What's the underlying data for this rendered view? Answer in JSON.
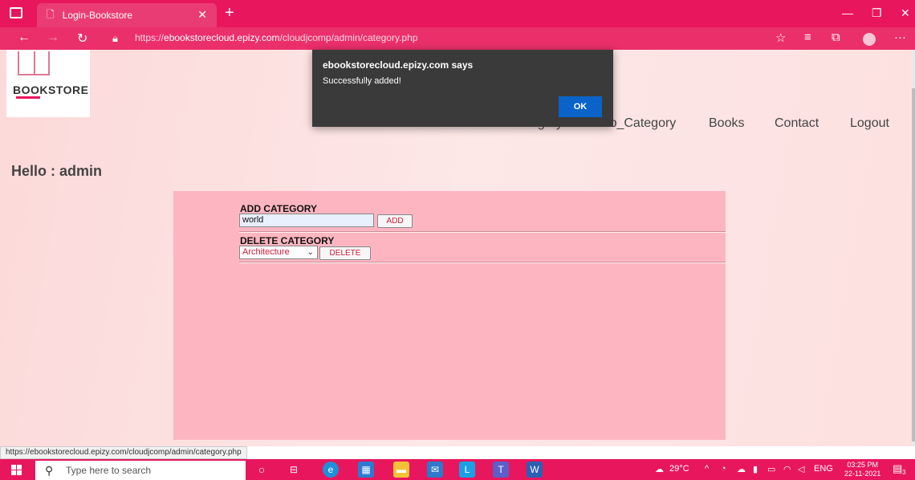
{
  "browser": {
    "tab_title": "Login-Bookstore",
    "url_prefix": "https://",
    "url_domain": "ebookstorecloud.epizy.com",
    "url_path": "/cloudjcomp/admin/category.php",
    "status_url": "https://ebookstorecloud.epizy.com/cloudjcomp/admin/category.php"
  },
  "logo": {
    "text_a": "BOOK",
    "text_b": "STORE"
  },
  "nav": {
    "category": "Category",
    "sub_category": "Sub_Category",
    "books": "Books",
    "contact": "Contact",
    "logout": "Logout"
  },
  "greeting": "Hello : admin",
  "add_category": {
    "label": "ADD CATEGORY",
    "value": "world",
    "button": "ADD"
  },
  "delete_category": {
    "label": "DELETE CATEGORY",
    "selected": "Architecture",
    "button": "DELETE"
  },
  "dialog": {
    "title": "ebookstorecloud.epizy.com says",
    "message": "Successfully added!",
    "ok": "OK"
  },
  "taskbar": {
    "search_placeholder": "Type here to search",
    "weather": "29°C",
    "lang": "ENG",
    "time": "03:25 PM",
    "date": "22-11-2021",
    "notifications": "3"
  },
  "icons": {
    "back": "arrow-left-icon",
    "forward": "arrow-right-icon",
    "refresh": "refresh-icon",
    "lock": "lock-icon"
  }
}
